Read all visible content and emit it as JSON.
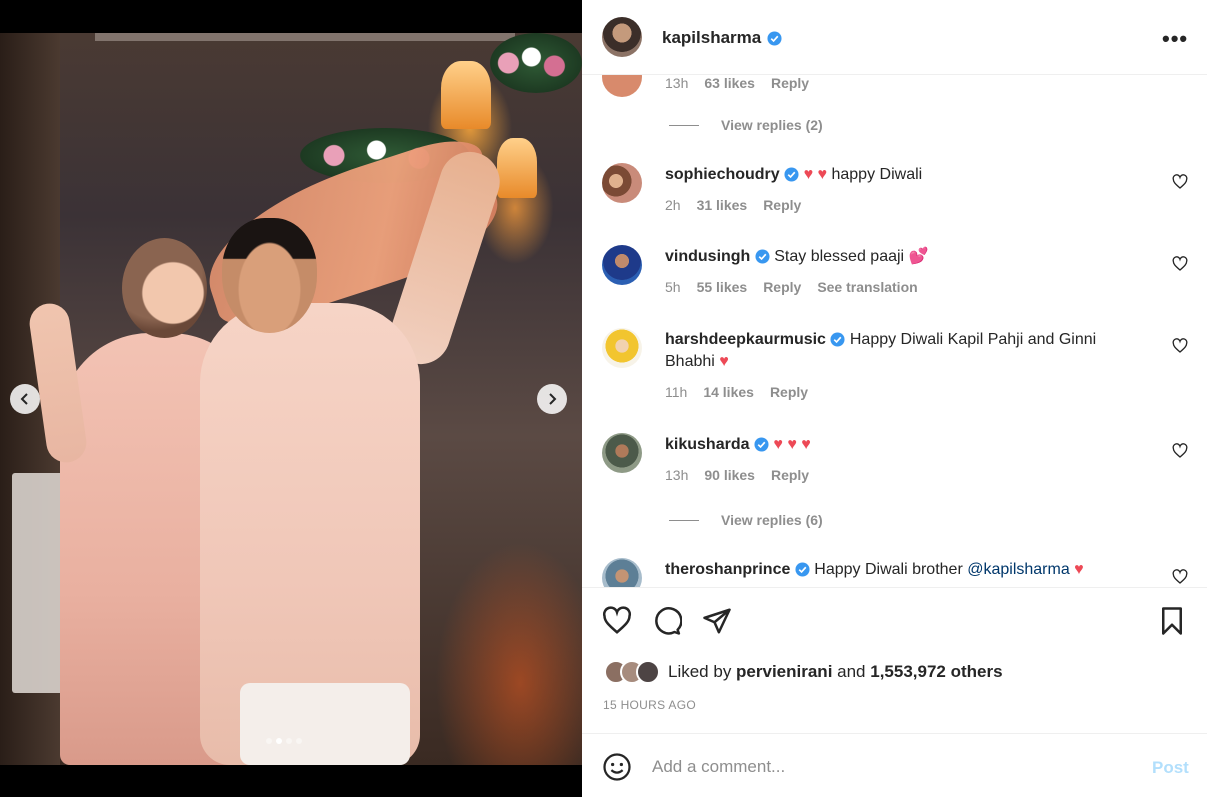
{
  "post": {
    "author": "kapilsharma",
    "more_label": "•••"
  },
  "carousel": {
    "slide_count": 4,
    "active_index": 1
  },
  "comments": [
    {
      "id": "c0",
      "partial": true,
      "meta": {
        "age": "13h",
        "likes": "63 likes",
        "reply": "Reply"
      },
      "view_replies": "View replies (2)"
    },
    {
      "id": "c1",
      "username": "sophiechoudry",
      "verified": true,
      "text_parts": [
        "♥ ♥ ",
        "happy Diwali"
      ],
      "meta": {
        "age": "2h",
        "likes": "31 likes",
        "reply": "Reply"
      }
    },
    {
      "id": "c2",
      "username": "vindusingh",
      "verified": true,
      "text": "Stay blessed paaji",
      "emoji": "💕",
      "meta": {
        "age": "5h",
        "likes": "55 likes",
        "reply": "Reply",
        "translate": "See translation"
      }
    },
    {
      "id": "c3",
      "username": "harshdeepkaurmusic",
      "verified": true,
      "text": "Happy Diwali Kapil Pahji and Ginni Bhabhi",
      "emoji": "♥",
      "meta": {
        "age": "11h",
        "likes": "14 likes",
        "reply": "Reply"
      }
    },
    {
      "id": "c4",
      "username": "kikusharda",
      "verified": true,
      "text": "♥ ♥ ♥",
      "meta": {
        "age": "13h",
        "likes": "90 likes",
        "reply": "Reply"
      },
      "view_replies": "View replies (6)"
    },
    {
      "id": "c5",
      "username": "theroshanprince",
      "verified": true,
      "text": "Happy Diwali brother ",
      "mention": "@kapilsharma",
      "emoji": "♥"
    }
  ],
  "actions": {
    "like_icon": "heart-outline-icon",
    "comment_icon": "comment-bubble-icon",
    "share_icon": "paper-plane-icon",
    "save_icon": "bookmark-icon"
  },
  "likes": {
    "prefix": "Liked by ",
    "first_user": "pervienirani",
    "joiner": " and ",
    "others": "1,553,972 others"
  },
  "timestamp": "15 HOURS AGO",
  "add_comment": {
    "placeholder": "Add a comment...",
    "post_label": "Post"
  },
  "colors": {
    "verified": "#3897f0",
    "heart": "#ed4956",
    "link": "#00376b",
    "post_disabled": "#b2dffc",
    "muted": "#8e8e8e"
  }
}
